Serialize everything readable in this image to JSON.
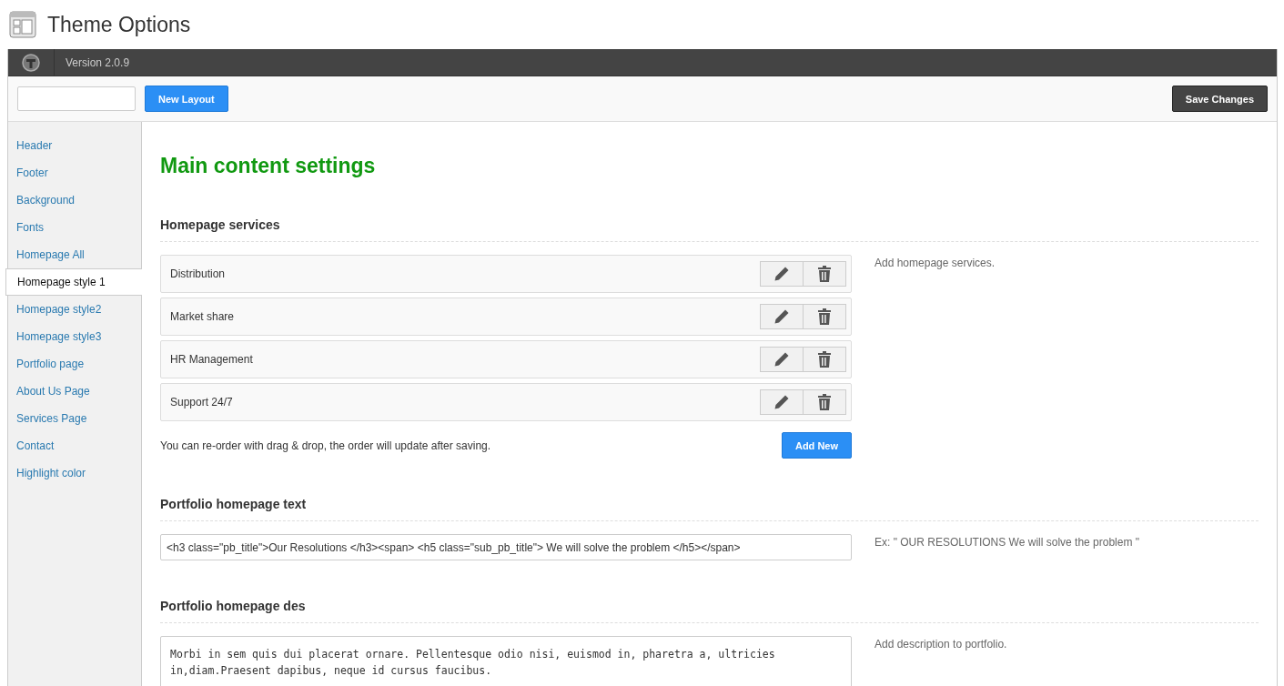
{
  "page_title": "Theme Options",
  "top_bar": {
    "version": "Version 2.0.9"
  },
  "toolbar": {
    "new_layout_button": "New Layout",
    "save_button": "Save Changes"
  },
  "sidebar": {
    "items": [
      {
        "label": "Header",
        "selected": false
      },
      {
        "label": "Footer",
        "selected": false
      },
      {
        "label": "Background",
        "selected": false
      },
      {
        "label": "Fonts",
        "selected": false
      },
      {
        "label": "Homepage All",
        "selected": false
      },
      {
        "label": "Homepage style 1",
        "selected": true
      },
      {
        "label": "Homepage style2",
        "selected": false
      },
      {
        "label": "Homepage style3",
        "selected": false
      },
      {
        "label": "Portfolio page",
        "selected": false
      },
      {
        "label": "About Us Page",
        "selected": false
      },
      {
        "label": "Services Page",
        "selected": false
      },
      {
        "label": "Contact",
        "selected": false
      },
      {
        "label": "Highlight color",
        "selected": false
      }
    ]
  },
  "content": {
    "heading": "Main content settings",
    "sections": [
      {
        "kind": "list",
        "title": "Homepage services",
        "description": "Add homepage services.",
        "items": [
          "Distribution",
          "Market share",
          "HR Management",
          "Support 24/7"
        ],
        "note": "You can re-order with drag & drop, the order will update after saving.",
        "add_button": "Add New"
      },
      {
        "kind": "input",
        "title": "Portfolio homepage text",
        "description": "Ex: \" OUR RESOLUTIONS We will solve the problem \"",
        "value": "<h3 class=\"pb_title\">Our Resolutions </h3><span> <h5 class=\"sub_pb_title\"> We will solve the problem </h5></span>"
      },
      {
        "kind": "textarea",
        "title": "Portfolio homepage des",
        "description": "Add description to portfolio.",
        "value": "Morbi in sem quis dui placerat ornare. Pellentesque odio nisi, euismod in, pharetra a, ultricies in,diam.Praesent dapibus, neque id cursus faucibus."
      }
    ]
  }
}
